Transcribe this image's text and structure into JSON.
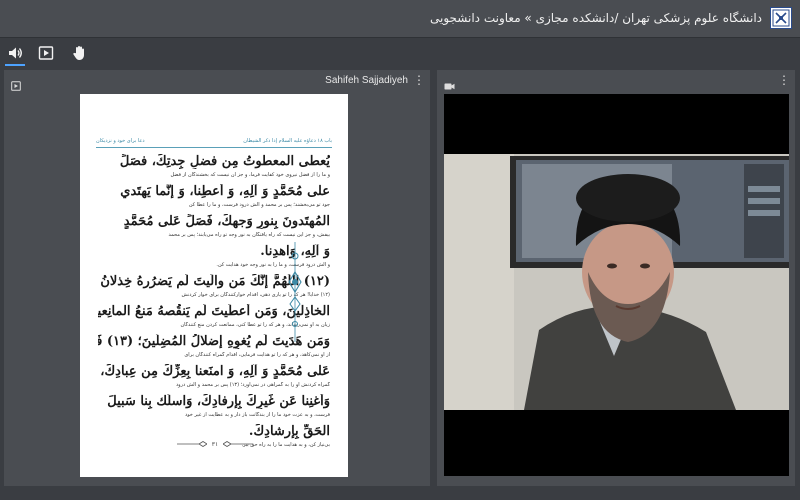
{
  "header": {
    "title": "دانشگاه علوم پزشکی تهران /دانشکده مجازی » معاونت دانشجویی"
  },
  "toolbar": {
    "icons": [
      "speaker-icon",
      "present-icon",
      "raise-hand-icon"
    ],
    "active_color": "#4da3ff"
  },
  "left_panel": {
    "title": "Sahifeh Sajjadiyeh",
    "document": {
      "header_right": "باب ۱۸ دعاؤه عليه السلام إذا ذكر الشيطان",
      "header_left": "دعا برای خود و نزدیکان",
      "lines": [
        {
          "kind": "ar",
          "text": "يُعطى المعطوتُ مِن فضلِ جِدتِكَ، فصَلِّ"
        },
        {
          "kind": "fa",
          "text": "و ما را از فضل نیروی خود کفایت فرما، و جز آن نیست که بخشندگان از فضل"
        },
        {
          "kind": "ar",
          "text": "على مُحَمَّدٍ وَ آلِهِ، وَ أَعطِنا، وَ إنَّما يَهتَدي"
        },
        {
          "kind": "fa",
          "text": "جود تو می‌بخشند؛ پس بر محمد و آلش درود فرست، و ما را عطا کن"
        },
        {
          "kind": "ar",
          "text": "المُهتَدونَ بِنورِ وَجهِكَ، فَصَلِّ عَلى مُحَمَّدٍ"
        },
        {
          "kind": "fa",
          "text": "بیفش، و جز این نیست که راه یافتگان به نور وجه تو راه می‌یابند؛ پس بر محمد"
        },
        {
          "kind": "ar",
          "text": "وَ آلِهِ، وَاهدِنا."
        },
        {
          "kind": "fa",
          "text": "و آلش درود فرست، و ما را به نور وجه خود هدایت کن."
        },
        {
          "kind": "ar",
          "text": "(١٢) اللّٰهُمَّ إنَّكَ مَن والَيتَ لَم يَضرُرهُ خِذلانُ"
        },
        {
          "kind": "fa",
          "text": "(١٢) خدایا! هر که را تو یاری دهی، اقدام خوارکنندگان برای خوار کردنش"
        },
        {
          "kind": "ar",
          "text": "الخاذِلينَ، وَمَن أعطَيتَ لَم يَنقُصهُ مَنعُ المانِعينَ،"
        },
        {
          "kind": "fa",
          "text": "زیان به او نمی‌رساند، و هر که را تو عطا کنی، ممانعت کردن منع کنندگان"
        },
        {
          "kind": "ar",
          "text": "وَمَن هَدَيتَ لَم يُغوِهِ إضلالُ المُضِلّينَ؛ (١٣) فَصَلِّ"
        },
        {
          "kind": "fa",
          "text": "از او نمی‌کاهد، و هر که را تو هدایت فرمایی، اقدام گمراه کنندگان برای"
        },
        {
          "kind": "ar",
          "text": "عَلى مُحَمَّدٍ وَ آلِهِ، وَ امنَعنا بِعِزِّكَ مِن عِبادِكَ،"
        },
        {
          "kind": "fa",
          "text": "گمراه کردنش او را به گمراهی در نمی‌آورد؛ (١٣) پس بر محمد و آلش درود"
        },
        {
          "kind": "ar",
          "text": "وَأغنِنا عَن غَيرِكَ بِإرفادِكَ، وَاسلُك بِنا سَبيلَ"
        },
        {
          "kind": "fa",
          "text": "فرست، و به عزت خود ما را از بندگانت باز دار و به عطایت از غیر خود"
        },
        {
          "kind": "ar",
          "text": "الحَقِّ بِإرشادِكَ."
        },
        {
          "kind": "fa",
          "text": "بی‌نیاز کن، و به هدایت ما را به راه حق ببر."
        }
      ],
      "page_number": "٣١"
    }
  },
  "right_panel": {
    "title": ""
  },
  "colors": {
    "top_bar": "#4a4d52",
    "background": "#3a3d42",
    "doc_accent": "#3c8aa6"
  }
}
